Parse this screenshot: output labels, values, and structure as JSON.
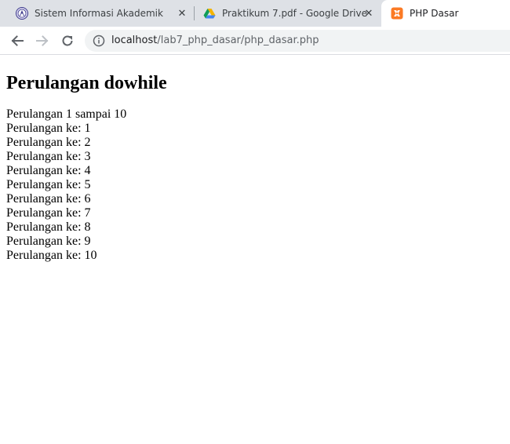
{
  "browser": {
    "tabs": [
      {
        "title": "Sistem Informasi Akademik",
        "icon": "university-seal-icon",
        "active": false
      },
      {
        "title": "Praktikum 7.pdf - Google Drive",
        "icon": "google-drive-icon",
        "active": false
      },
      {
        "title": "PHP Dasar",
        "icon": "xampp-icon",
        "active": true
      }
    ],
    "close_glyph": "✕",
    "address": {
      "host": "localhost",
      "path": "/lab7_php_dasar/php_dasar.php"
    }
  },
  "page": {
    "heading": "Perulangan dowhile",
    "intro": "Perulangan 1 sampai 10",
    "lines": [
      "Perulangan ke: 1",
      "Perulangan ke: 2",
      "Perulangan ke: 3",
      "Perulangan ke: 4",
      "Perulangan ke: 5",
      "Perulangan ke: 6",
      "Perulangan ke: 7",
      "Perulangan ke: 8",
      "Perulangan ke: 9",
      "Perulangan ke: 10"
    ]
  },
  "colors": {
    "tabstrip": "#dee1e6",
    "omnibox": "#f1f3f4",
    "drive_green": "#0f9d58",
    "drive_yellow": "#f4b400",
    "drive_blue": "#4285f4",
    "xampp_orange": "#fb7a24",
    "seal_purple": "#3d3a8c"
  }
}
